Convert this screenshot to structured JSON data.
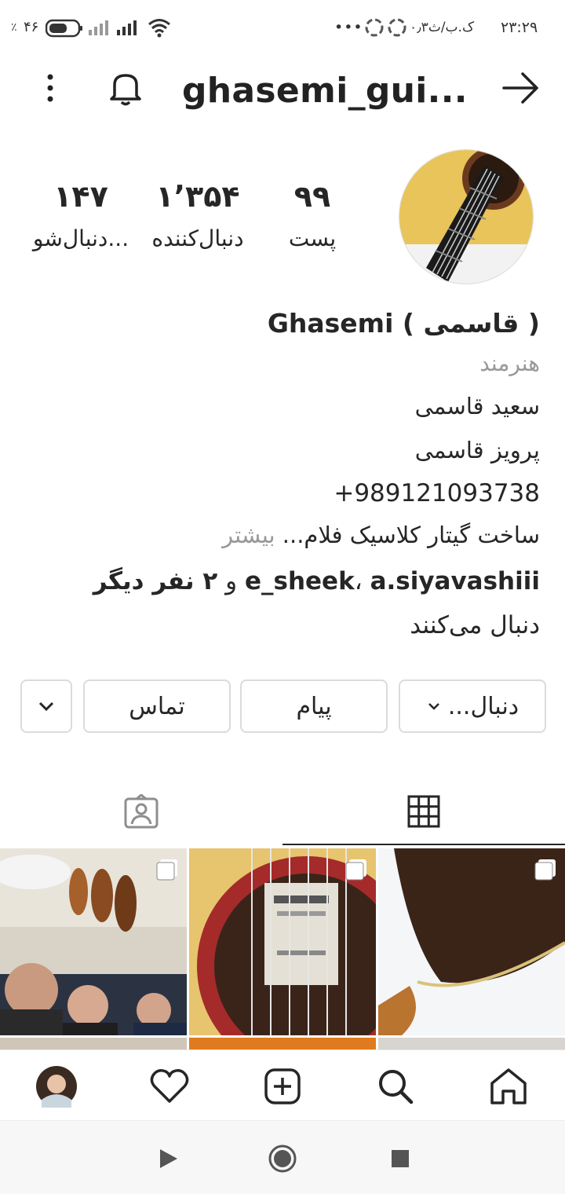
{
  "status_bar": {
    "time": "۲۳:۲۹",
    "speed": "۰٫۳ک.ب/ث",
    "more": "•••",
    "battery_percent": "۴۶",
    "percent_sign": "٪"
  },
  "header": {
    "username": "ghasemi_gui..."
  },
  "stats": {
    "posts_count": "۹۹",
    "posts_label": "پست",
    "followers_count": "۱٬۳۵۴",
    "followers_label": "دنبال‌کننده",
    "following_count": "۱۴۷",
    "following_label": "دنبال‌شو..."
  },
  "bio": {
    "name": "Ghasemi ( قاسمی )",
    "category": "هنرمند",
    "line1": "سعید قاسمی",
    "line2": "پرویز قاسمی",
    "phone": "+989121093738",
    "desc": "ساخت گیتار کلاسیک فلام...",
    "more": "بیشتر"
  },
  "followed_by": {
    "users": "e_sheek",
    "users2": "a.siyavashiii",
    "sep": "، ",
    "and": " و ",
    "others": "۲ نفر دیگر",
    "suffix": " دنبال می‌کنند"
  },
  "buttons": {
    "follow": "دنبال...",
    "message": "پیام",
    "contact": "تماس"
  },
  "icons": {
    "back": "arrow-right-icon",
    "bell": "bell-icon",
    "menu": "more-vertical-icon",
    "grid": "grid-icon",
    "tagged": "tagged-person-icon",
    "home": "home-icon",
    "search": "search-icon",
    "add": "add-post-icon",
    "heart": "heart-icon"
  }
}
